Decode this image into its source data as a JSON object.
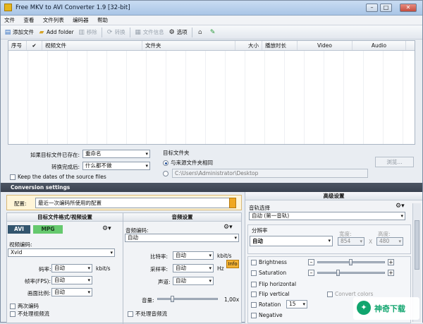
{
  "window": {
    "title": "Free MKV to AVI Converter 1.9  [32-bit]"
  },
  "menu": [
    "文件",
    "查看",
    "文件列表",
    "编码器",
    "帮助"
  ],
  "toolbar": {
    "add_files": "添加文件",
    "add_folder": "Add folder",
    "remove": "移除",
    "convert": "转换",
    "file_info": "文件信息",
    "options": "选项"
  },
  "grid": {
    "columns": [
      "序号",
      "✔",
      "视频文件",
      "文件夹",
      "大小",
      "播放时长",
      "Video",
      "Audio"
    ]
  },
  "options": {
    "if_exists_label": "如果目标文件已存在:",
    "if_exists_value": "重命名",
    "after_label": "转换完成后:",
    "after_value": "什么都不做",
    "keep_dates": "Keep the dates of the source files",
    "target_folder_title": "目标文件夹",
    "same_as_source": "与来源文件夹相同",
    "folder_path": "C:\\Users\\Administrator\\Desktop",
    "browse": "浏览..."
  },
  "conversion": {
    "section": "Conversion settings",
    "preset_label": "配置:",
    "preset_value": "最近一次编码所使用的配置"
  },
  "left": {
    "video_header": "目标文件格式/视频设置",
    "tab_avi": "AVI",
    "tab_mpg": "MPG",
    "video_codec_label": "视频编码:",
    "video_codec": "Xvid",
    "bitrate_label": "码率:",
    "bitrate": "自动",
    "bitrate_unit": "kbit/s",
    "fps_label": "帧率(FPS):",
    "fps": "自动",
    "aspect_label": "画面比例:",
    "aspect": "自动",
    "two_pass": "两次编码",
    "no_video": "不处理视频流"
  },
  "audio": {
    "header": "音频设置",
    "codec_label": "音频编码:",
    "codec": "自动",
    "bitrate_label": "比特率:",
    "bitrate": "自动",
    "bitrate_unit": "kbit/s",
    "samplerate_label": "采样率:",
    "samplerate": "自动",
    "samplerate_unit": "Hz",
    "info": "Info",
    "channels_label": "声道:",
    "channels": "自动",
    "volume_label": "音量:",
    "volume_value": "1,00x",
    "volume_level": 0.22,
    "no_audio": "不处理音频流"
  },
  "advanced": {
    "header": "高级设置",
    "track_label": "音轨选择",
    "track_value": "自动 (第一音轨)",
    "resolution_label": "分辨率",
    "resolution_value": "自动",
    "width_label": "宽度:",
    "width": "854",
    "x": "X",
    "height_label": "高度:",
    "height": "480",
    "brightness": "Brightness",
    "saturation": "Saturation",
    "flip_h": "Flip horizontal",
    "flip_v": "Flip vertical",
    "rotation": "Rotation",
    "rotation_value": "15",
    "negative": "Negative",
    "convert_colors": "Convert colors"
  },
  "watermark": {
    "text": "神奇下载"
  }
}
